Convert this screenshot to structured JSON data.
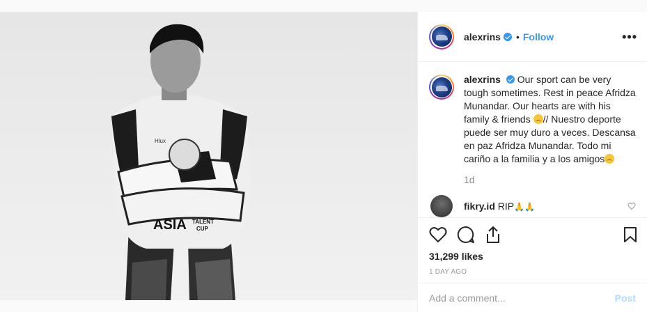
{
  "post": {
    "image_alt": "Black and white photo of a rider in racing leathers with arms crossed",
    "image_texts": {
      "sponsor_line1": "ASIA",
      "sponsor_line2": "TALENT CUP",
      "brand_small": "Hlux"
    }
  },
  "header": {
    "username": "alexrins",
    "dot": "•",
    "follow_label": "Follow",
    "more_label": "•••"
  },
  "caption": {
    "username": "alexrins",
    "text_part1": "Our sport can be very tough sometimes. Rest in peace Afridza Munandar. Our hearts are with his family & friends ",
    "text_part2": "// Nuestro deporte puede ser muy duro a veces. Descansa en paz Afridza Munandar. Todo mi cariño a la familia y a los amigos",
    "time": "1d"
  },
  "comment": {
    "username": "fikry.id",
    "text": "RIP",
    "emoji": "🙏🙏"
  },
  "stats": {
    "likes": "31,299 likes",
    "timestamp": "1 day ago"
  },
  "add_comment": {
    "placeholder": "Add a comment...",
    "post_label": "Post"
  },
  "colors": {
    "accent": "#3897f0",
    "post_disabled": "#b3dbff",
    "muted": "#8e8e8e",
    "border": "#efefef"
  }
}
